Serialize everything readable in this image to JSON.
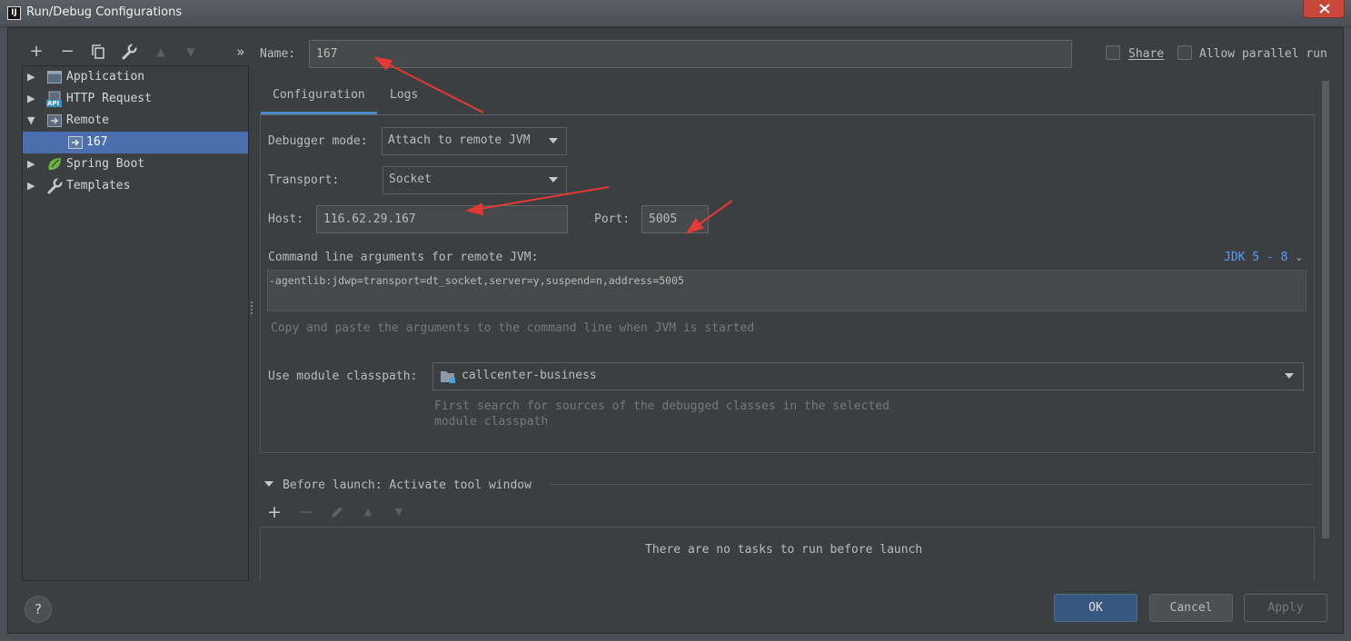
{
  "window": {
    "title": "Run/Debug Configurations",
    "app_icon_text": "IJ"
  },
  "toolbar": {
    "add": "+",
    "remove": "−",
    "copy": "copy-icon",
    "edit_templates": "wrench-icon",
    "move_up": "▲",
    "move_down": "▼",
    "more": "»"
  },
  "tree": {
    "items": [
      {
        "label": "Application",
        "icon": "application-icon",
        "expanded": false
      },
      {
        "label": "HTTP Request",
        "icon": "api-icon",
        "expanded": false
      },
      {
        "label": "Remote",
        "icon": "remote-icon",
        "expanded": true
      },
      {
        "label": "167",
        "icon": "remote-config-icon",
        "selected": true
      },
      {
        "label": "Spring Boot",
        "icon": "spring-boot-icon",
        "expanded": false
      },
      {
        "label": "Templates",
        "icon": "wrench-icon",
        "expanded": false
      }
    ],
    "api_badge": "API"
  },
  "name": {
    "label": "Name:",
    "value": "167"
  },
  "share": {
    "label": "Share",
    "checked": false
  },
  "parallel": {
    "label": "Allow parallel run",
    "checked": false
  },
  "tabs": [
    {
      "label": "Configuration",
      "active": true
    },
    {
      "label": "Logs",
      "active": false
    }
  ],
  "config": {
    "debugger_mode": {
      "label": "Debugger mode:",
      "value": "Attach to remote JVM"
    },
    "transport": {
      "label": "Transport:",
      "value": "Socket"
    },
    "host": {
      "label": "Host:",
      "value": "116.62.29.167"
    },
    "port": {
      "label": "Port:",
      "value": "5005"
    },
    "cmd_args": {
      "label": "Command line arguments for remote JVM:",
      "jdk": "JDK 5 - 8",
      "value": "-agentlib:jdwp=transport=dt_socket,server=y,suspend=n,address=5005",
      "hint": "Copy and paste the arguments to the command line when JVM is started"
    },
    "module_classpath": {
      "label": "Use module classpath:",
      "value": "callcenter-business",
      "hint_line1": "First search for sources of the debugged classes in the selected",
      "hint_line2": "module classpath"
    }
  },
  "before_launch": {
    "title": "Before launch: Activate tool window",
    "empty_text": "There are no tasks to run before launch"
  },
  "buttons": {
    "ok": "OK",
    "cancel": "Cancel",
    "apply": "Apply",
    "help": "?"
  },
  "colors": {
    "background": "#3c3f41",
    "selection": "#4b6eaf",
    "accent": "#4a88c7",
    "link": "#589df6",
    "annotation": "#e53935"
  }
}
